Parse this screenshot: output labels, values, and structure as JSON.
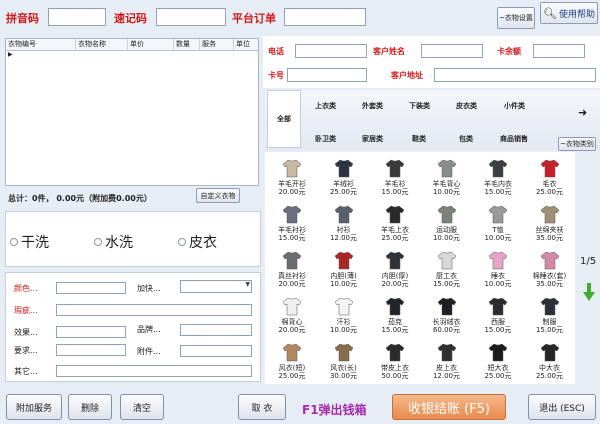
{
  "top": {
    "pinyin_label": "拼音码",
    "quick_label": "速记码",
    "platform_label": "平台订单",
    "clothes_settings": "~衣物设置",
    "help": "使用帮助"
  },
  "grid": {
    "columns": [
      "衣物编号",
      "衣物名称",
      "单价",
      "数量",
      "服务",
      "单位"
    ]
  },
  "summary": {
    "total": "总计：0件， 0.00元（附加费0.00元）",
    "custom_btn": "自定义衣物"
  },
  "wash": [
    "干洗",
    "水洗",
    "皮衣"
  ],
  "form": {
    "color": "颜色...",
    "urgent": "加快...",
    "flaw": "瑕疵...",
    "effect": "效果...",
    "brand": "品牌...",
    "require": "要求...",
    "accessory": "附件...",
    "other": "其它..."
  },
  "customer": {
    "phone": "电话",
    "name": "客户姓名",
    "balance": "卡余额",
    "card": "卡号",
    "address": "客户地址"
  },
  "categories": {
    "all": "全部",
    "row1": [
      "上衣类",
      "外套类",
      "下装类",
      "皮衣类",
      "小件类"
    ],
    "row2": [
      "卧卫类",
      "家居类",
      "鞋类",
      "包类",
      "商品销售"
    ],
    "category_btn": "~衣物类别"
  },
  "products": [
    {
      "name": "羊毛开衫",
      "price": "20.00元",
      "color": "#c9b7a0"
    },
    {
      "name": "羊绒衫",
      "price": "25.00元",
      "color": "#2f3540"
    },
    {
      "name": "羊毛衫",
      "price": "15.00元",
      "color": "#3a3a3a"
    },
    {
      "name": "羊毛背心",
      "price": "10.00元",
      "color": "#8a8e8a"
    },
    {
      "name": "羊毛内衣",
      "price": "15.00元",
      "color": "#3c3f44"
    },
    {
      "name": "毛衣",
      "price": "25.00元",
      "color": "#c8202a"
    },
    {
      "name": "羊毛衬衫",
      "price": "15.00元",
      "color": "#6a7080"
    },
    {
      "name": "衬衫",
      "price": "12.00元",
      "color": "#5a6070"
    },
    {
      "name": "羊毛上衣",
      "price": "25.00元",
      "color": "#2a2a2a"
    },
    {
      "name": "运动服",
      "price": "10.00元",
      "color": "#7c8378"
    },
    {
      "name": "T恤",
      "price": "10.00元",
      "color": "#9a9a9a"
    },
    {
      "name": "丝绵夹袄",
      "price": "35.00元",
      "color": "#a09078"
    },
    {
      "name": "真丝衬衫",
      "price": "20.00元",
      "color": "#6a6d73"
    },
    {
      "name": "内胆(薄)",
      "price": "10.00元",
      "color": "#a82828"
    },
    {
      "name": "内胆(厚)",
      "price": "20.00元",
      "color": "#30343a"
    },
    {
      "name": "厨工衣",
      "price": "15.00元",
      "color": "#d8d8d8"
    },
    {
      "name": "睡衣",
      "price": "10.00元",
      "color": "#e8a6c6"
    },
    {
      "name": "棉睡衣(套)",
      "price": "35.00元",
      "color": "#d28aa8"
    },
    {
      "name": "棉背心",
      "price": "20.00元",
      "color": "#efefef"
    },
    {
      "name": "汗衫",
      "price": "10.00元",
      "color": "#f4f4f4"
    },
    {
      "name": "茄克",
      "price": "15.00元",
      "color": "#22252a"
    },
    {
      "name": "长羽绒衣",
      "price": "60.00元",
      "color": "#1e1f22"
    },
    {
      "name": "西服",
      "price": "15.00元",
      "color": "#2a2c30"
    },
    {
      "name": "制服",
      "price": "15.00元",
      "color": "#2d3038"
    },
    {
      "name": "风衣(短)",
      "price": "25.00元",
      "color": "#b08a5e"
    },
    {
      "name": "风衣(长)",
      "price": "30.00元",
      "color": "#8a6e4e"
    },
    {
      "name": "带皮上衣",
      "price": "50.00元",
      "color": "#2b2b2b"
    },
    {
      "name": "皮上衣",
      "price": "12.00元",
      "color": "#303030"
    },
    {
      "name": "短大衣",
      "price": "25.00元",
      "color": "#1c1c1c"
    },
    {
      "name": "中大衣",
      "price": "25.00元",
      "color": "#262626"
    }
  ],
  "pager": "1/5",
  "bottom": {
    "extra": "附加服务",
    "delete": "删除",
    "clear": "清空",
    "pickup": "取 衣",
    "cashbox": "F1弹出钱箱",
    "checkout": "收银结账 (F5)",
    "exit": "退出 (ESC)"
  },
  "colors": {
    "accent": "#d21919",
    "checkout": "#f0a070",
    "arrow": "#3fae2e"
  }
}
